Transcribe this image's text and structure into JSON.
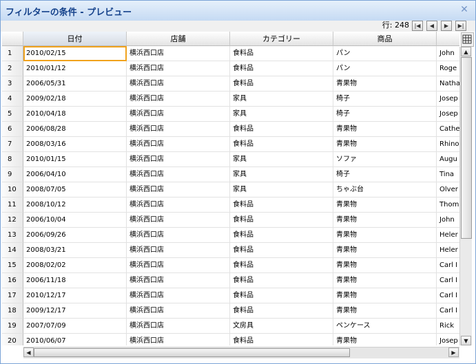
{
  "window": {
    "title": "フィルターの条件 - プレビュー",
    "close_glyph": "✕"
  },
  "toolbar": {
    "row_count": "行: 248",
    "first_glyph": "|◀",
    "prev_glyph": "◀",
    "next_glyph": "▶",
    "last_glyph": "▶|"
  },
  "columns": [
    "日付",
    "店舗",
    "カテゴリー",
    "商品",
    ""
  ],
  "rows": [
    {
      "n": "1",
      "date": "2010/02/15",
      "store": "横浜西口店",
      "category": "食料品",
      "product": "パン",
      "name": "John"
    },
    {
      "n": "2",
      "date": "2010/01/12",
      "store": "横浜西口店",
      "category": "食料品",
      "product": "パン",
      "name": "Roge"
    },
    {
      "n": "3",
      "date": "2006/05/31",
      "store": "横浜西口店",
      "category": "食料品",
      "product": "青果物",
      "name": "Natha"
    },
    {
      "n": "4",
      "date": "2009/02/18",
      "store": "横浜西口店",
      "category": "家具",
      "product": "椅子",
      "name": "Josep"
    },
    {
      "n": "5",
      "date": "2010/04/18",
      "store": "横浜西口店",
      "category": "家具",
      "product": "椅子",
      "name": "Josep"
    },
    {
      "n": "6",
      "date": "2006/08/28",
      "store": "横浜西口店",
      "category": "食料品",
      "product": "青果物",
      "name": "Cathe"
    },
    {
      "n": "7",
      "date": "2008/03/16",
      "store": "横浜西口店",
      "category": "食料品",
      "product": "青果物",
      "name": "Rhino"
    },
    {
      "n": "8",
      "date": "2010/01/15",
      "store": "横浜西口店",
      "category": "家具",
      "product": "ソファ",
      "name": "Augu"
    },
    {
      "n": "9",
      "date": "2006/04/10",
      "store": "横浜西口店",
      "category": "家具",
      "product": "椅子",
      "name": "Tina"
    },
    {
      "n": "10",
      "date": "2008/07/05",
      "store": "横浜西口店",
      "category": "家具",
      "product": "ちゃぶ台",
      "name": "Olver"
    },
    {
      "n": "11",
      "date": "2008/10/12",
      "store": "横浜西口店",
      "category": "食料品",
      "product": "青果物",
      "name": "Thom"
    },
    {
      "n": "12",
      "date": "2006/10/04",
      "store": "横浜西口店",
      "category": "食料品",
      "product": "青果物",
      "name": "John"
    },
    {
      "n": "13",
      "date": "2006/09/26",
      "store": "横浜西口店",
      "category": "食料品",
      "product": "青果物",
      "name": "Heler"
    },
    {
      "n": "14",
      "date": "2008/03/21",
      "store": "横浜西口店",
      "category": "食料品",
      "product": "青果物",
      "name": "Heler"
    },
    {
      "n": "15",
      "date": "2008/02/02",
      "store": "横浜西口店",
      "category": "食料品",
      "product": "青果物",
      "name": "Carl I"
    },
    {
      "n": "16",
      "date": "2006/11/18",
      "store": "横浜西口店",
      "category": "食料品",
      "product": "青果物",
      "name": "Carl I"
    },
    {
      "n": "17",
      "date": "2010/12/17",
      "store": "横浜西口店",
      "category": "食料品",
      "product": "青果物",
      "name": "Carl I"
    },
    {
      "n": "18",
      "date": "2009/12/17",
      "store": "横浜西口店",
      "category": "食料品",
      "product": "青果物",
      "name": "Carl I"
    },
    {
      "n": "19",
      "date": "2007/07/09",
      "store": "横浜西口店",
      "category": "文房具",
      "product": "ペンケース",
      "name": "Rick"
    },
    {
      "n": "20",
      "date": "2010/06/07",
      "store": "横浜西口店",
      "category": "食料品",
      "product": "青果物",
      "name": "Josep"
    }
  ],
  "scroll": {
    "up": "▲",
    "down": "▼",
    "left": "◀",
    "right": "▶"
  },
  "colors": {
    "title_text": "#15428b",
    "active_cell_border": "#f0a21c"
  },
  "icons": {
    "columns_chooser": "grid-columns-icon"
  }
}
